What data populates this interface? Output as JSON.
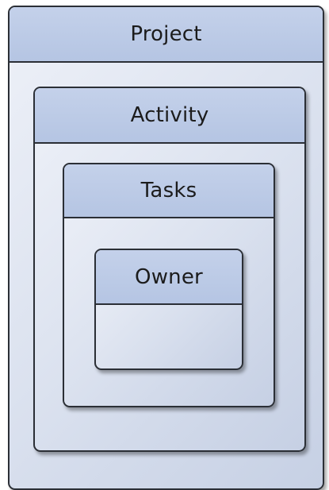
{
  "diagram": {
    "containers": {
      "project": {
        "label": "Project"
      },
      "activity": {
        "label": "Activity"
      },
      "tasks": {
        "label": "Tasks"
      },
      "owner": {
        "label": "Owner"
      }
    },
    "colors": {
      "header_fill": "#b5c5e3",
      "body_fill": "#d9e0ee",
      "border": "#2b2f36",
      "text": "#1c1c1c"
    }
  }
}
